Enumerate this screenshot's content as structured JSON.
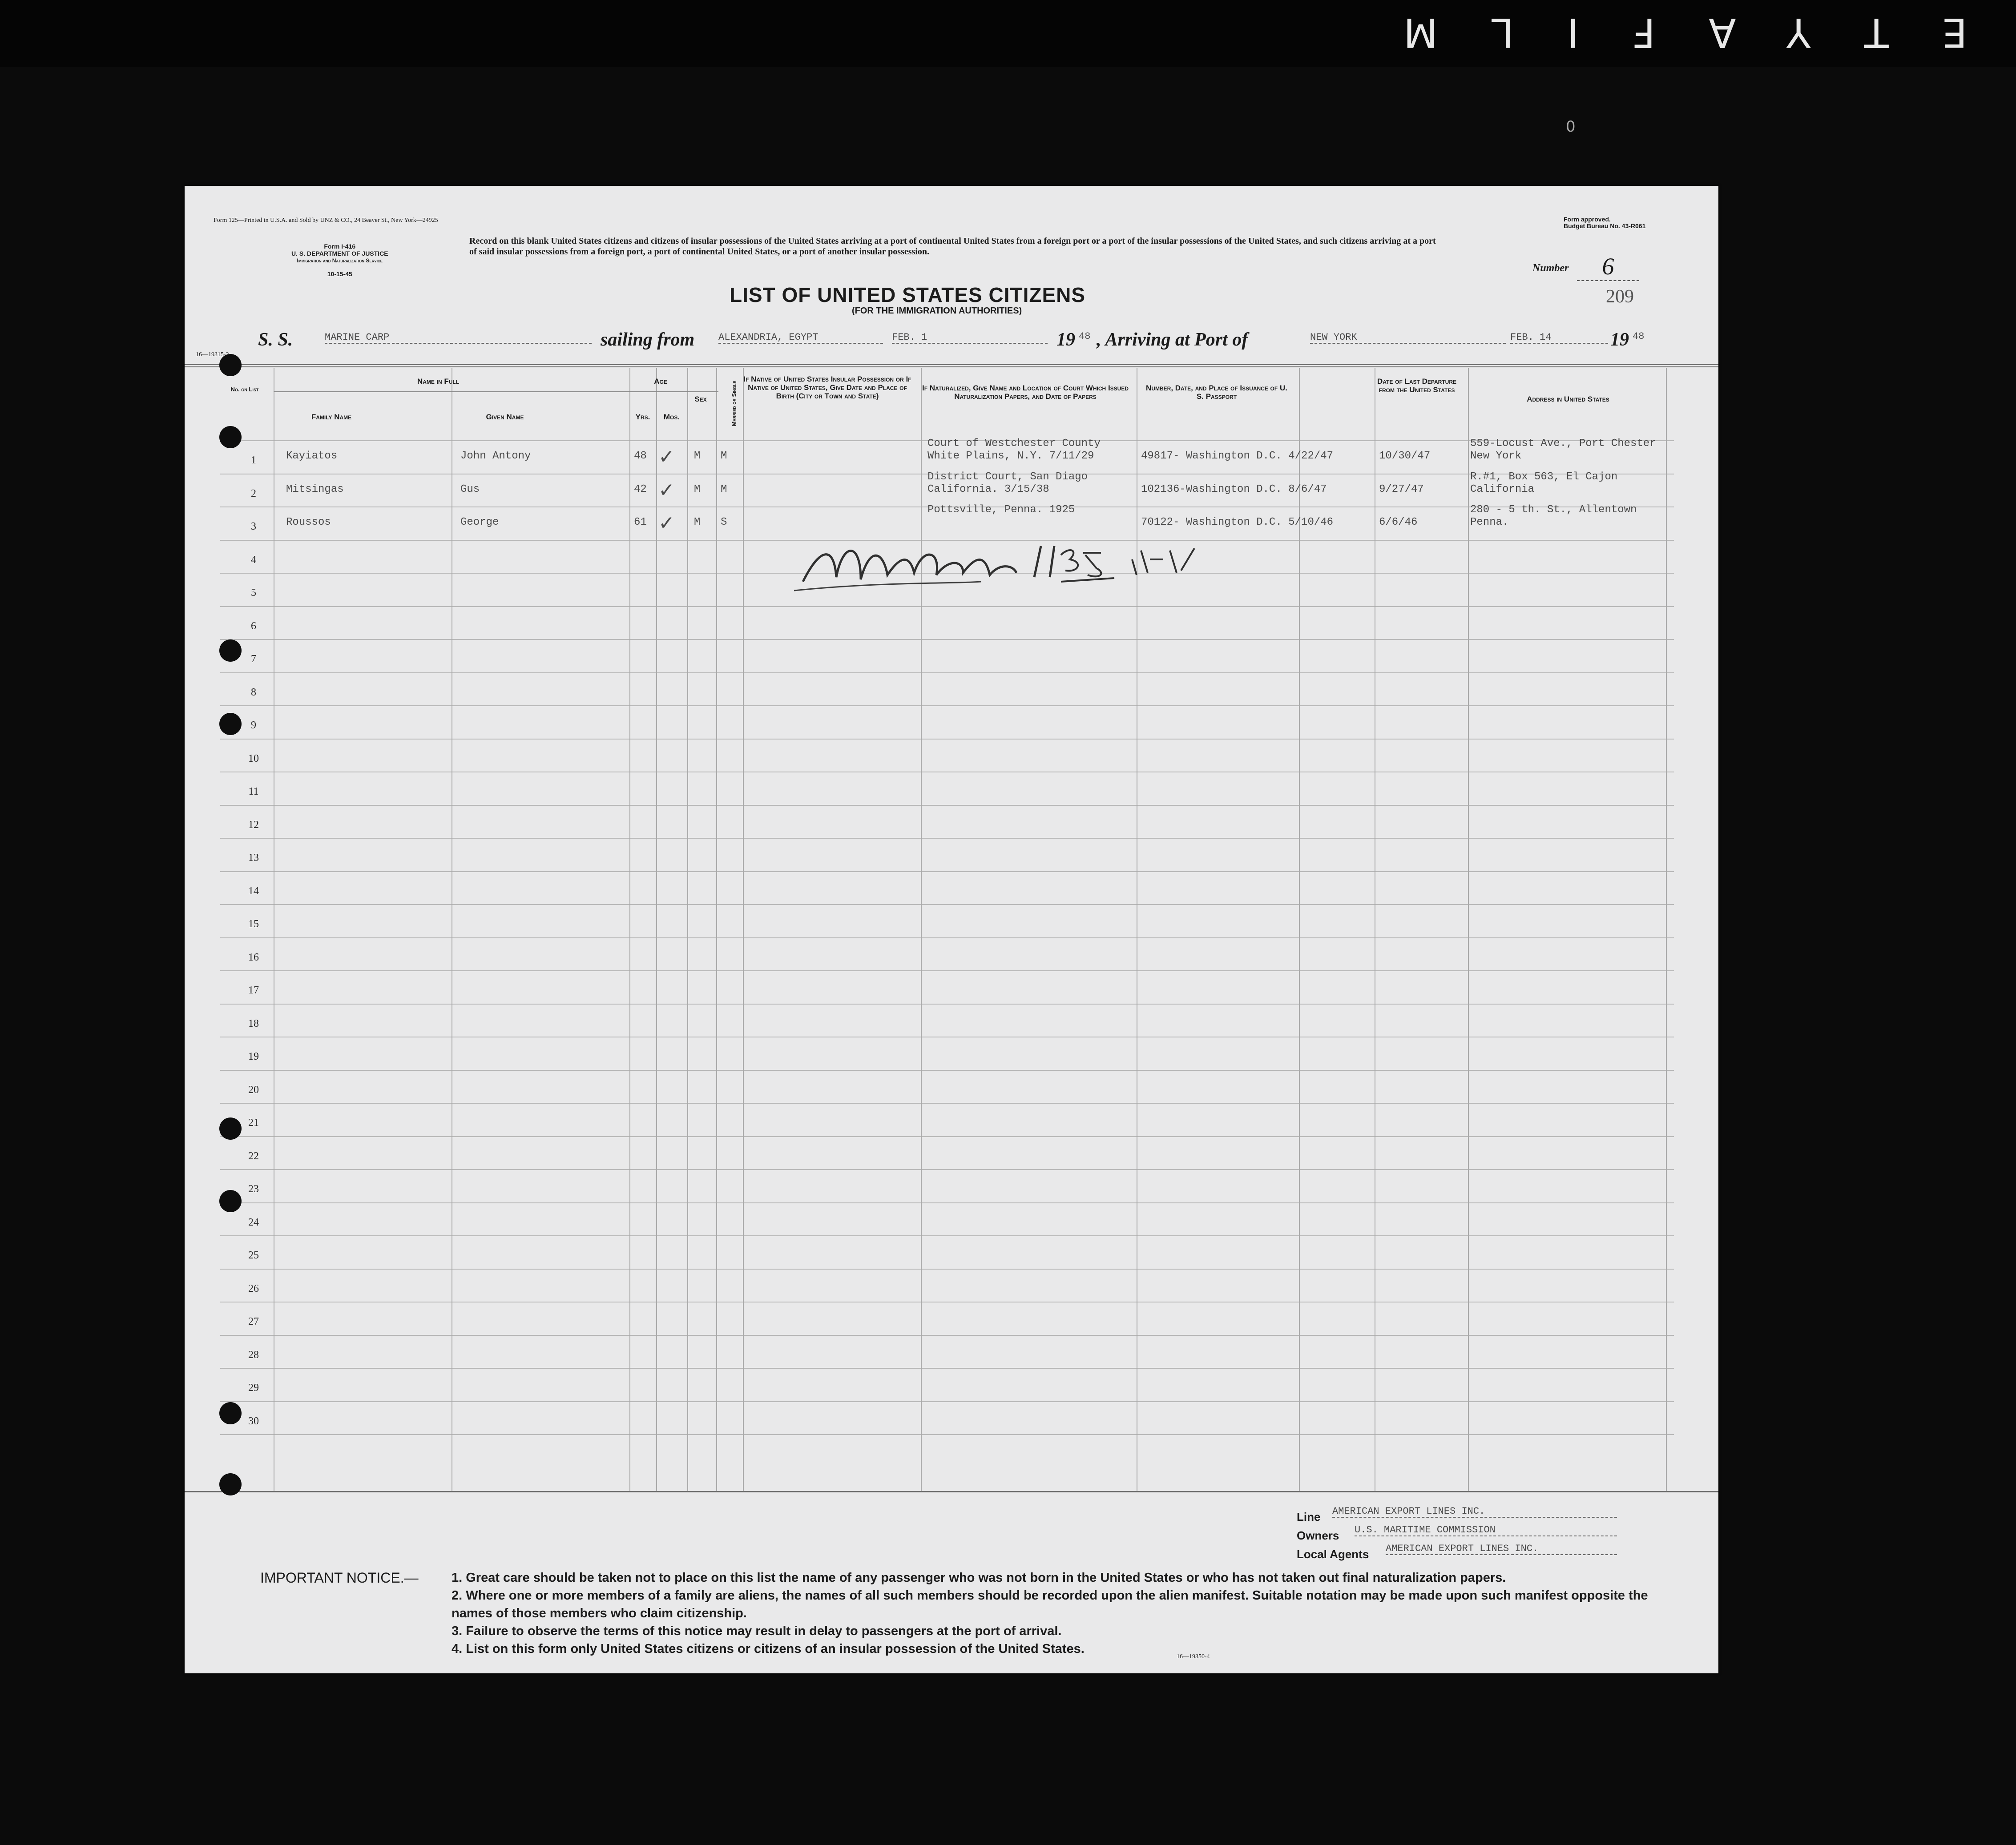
{
  "film": {
    "banner": "ETYAFILM",
    "mark": "0"
  },
  "form": {
    "printer_line": "Form 125—Printed in U.S.A. and Sold by UNZ & CO., 24 Beaver St., New York—24925",
    "form_id": "Form I-416",
    "dept": "U. S. DEPARTMENT OF JUSTICE",
    "service": "Immigration and Naturalization Service",
    "date": "10-15-45",
    "approval_1": "Form approved.",
    "approval_2": "Budget Bureau No. 43-R061",
    "instruction": "Record on this blank United States citizens and citizens of insular possessions of the United States arriving at a port of continental United States from a foreign port or a port of the insular possessions of the United States, and such citizens arriving at a port of said insular possessions from a foreign port, a port of continental United States, or a port of another insular possession.",
    "title": "LIST OF UNITED STATES CITIZENS",
    "subtitle": "(FOR THE IMMIGRATION AUTHORITIES)",
    "number_label": "Number",
    "number_value": "6",
    "page_stamp": "209",
    "side_code": "16—19315-2",
    "footer_code": "16—19350-4"
  },
  "voyage": {
    "ss_label": "S. S.",
    "ship": "MARINE CARP",
    "sailing_label": "sailing from",
    "from_port": "ALEXANDRIA, EGYPT",
    "from_date": "FEB. 1",
    "year_prefix": "19",
    "from_year": "48",
    "arriving_label": ", Arriving at Port of",
    "to_port": "NEW YORK",
    "to_date": "FEB. 14",
    "to_year": "48"
  },
  "columns": {
    "no": "No. on List",
    "name_in_full": "Name in Full",
    "family": "Family Name",
    "given": "Given Name",
    "age": "Age",
    "yrs": "Yrs.",
    "mos": "Mos.",
    "sex": "Sex",
    "married": "Married or Single",
    "native": "If Native of United States Insular Possession or If Native of United States, Give Date and Place of Birth (City or Town and State)",
    "naturalized": "If Naturalized, Give Name and Location of Court Which Issued Naturalization Papers, and Date of Papers",
    "passport": "Number, Date, and Place of Issuance of U. S. Passport",
    "departure": "Date of Last Departure from the United States",
    "address": "Address in United States"
  },
  "row_numbers": [
    "1",
    "2",
    "3",
    "4",
    "5",
    "6",
    "7",
    "8",
    "9",
    "10",
    "11",
    "12",
    "13",
    "14",
    "15",
    "16",
    "17",
    "18",
    "19",
    "20",
    "21",
    "22",
    "23",
    "24",
    "25",
    "26",
    "27",
    "28",
    "29",
    "30"
  ],
  "passengers": [
    {
      "family": "Kayiatos",
      "given": "John Antony",
      "yrs": "48",
      "mos": "✓",
      "sex": "M",
      "status": "M",
      "native": "",
      "naturalized_1": "Court of Westchester County",
      "naturalized_2": "White Plains, N.Y. 7/11/29",
      "passport": "49817- Washington D.C. 4/22/47",
      "departure": "10/30/47",
      "address_1": "559-Locust Ave., Port Chester",
      "address_2": "New York"
    },
    {
      "family": "Mitsingas",
      "given": "Gus",
      "yrs": "42",
      "mos": "✓",
      "sex": "M",
      "status": "M",
      "native": "",
      "naturalized_1": "District Court, San Diago",
      "naturalized_2": "California. 3/15/38",
      "passport": "102136-Washington D.C. 8/6/47",
      "departure": "9/27/47",
      "address_1": "R.#1, Box 563, El Cajon",
      "address_2": "California"
    },
    {
      "family": "Roussos",
      "given": "George",
      "yrs": "61",
      "mos": "✓",
      "sex": "M",
      "status": "S",
      "native": "",
      "naturalized_1": "Pottsville, Penna. 1925",
      "naturalized_2": "",
      "passport": "70122- Washington D.C. 5/10/46",
      "departure": "6/6/46",
      "address_1": "280 - 5 th. St., Allentown",
      "address_2": "Penna."
    }
  ],
  "signature": {
    "text": "MacWoolie 11 35 AM 2/14/48"
  },
  "agents": {
    "line_label": "Line",
    "line_value": "AMERICAN EXPORT LINES INC.",
    "owners_label": "Owners",
    "owners_value": "U.S. MARITIME COMMISSION",
    "local_label": "Local Agents",
    "local_value": "AMERICAN EXPORT LINES INC."
  },
  "notice": {
    "heading": "IMPORTANT NOTICE.—",
    "item1": "1. Great care should be taken not to place on this list the name of any passenger who was not born in the United States or who has not taken out final naturalization papers.",
    "item2": "2. Where one or more members of a family are aliens, the names of all such members should be recorded upon the alien manifest. Suitable notation may be made upon such manifest opposite the names of those members who claim citizenship.",
    "item3": "3. Failure to observe the terms of this notice may result in delay to passengers at the port of arrival.",
    "item4": "4. List on this form only United States citizens or citizens of an insular possession of the United States."
  }
}
